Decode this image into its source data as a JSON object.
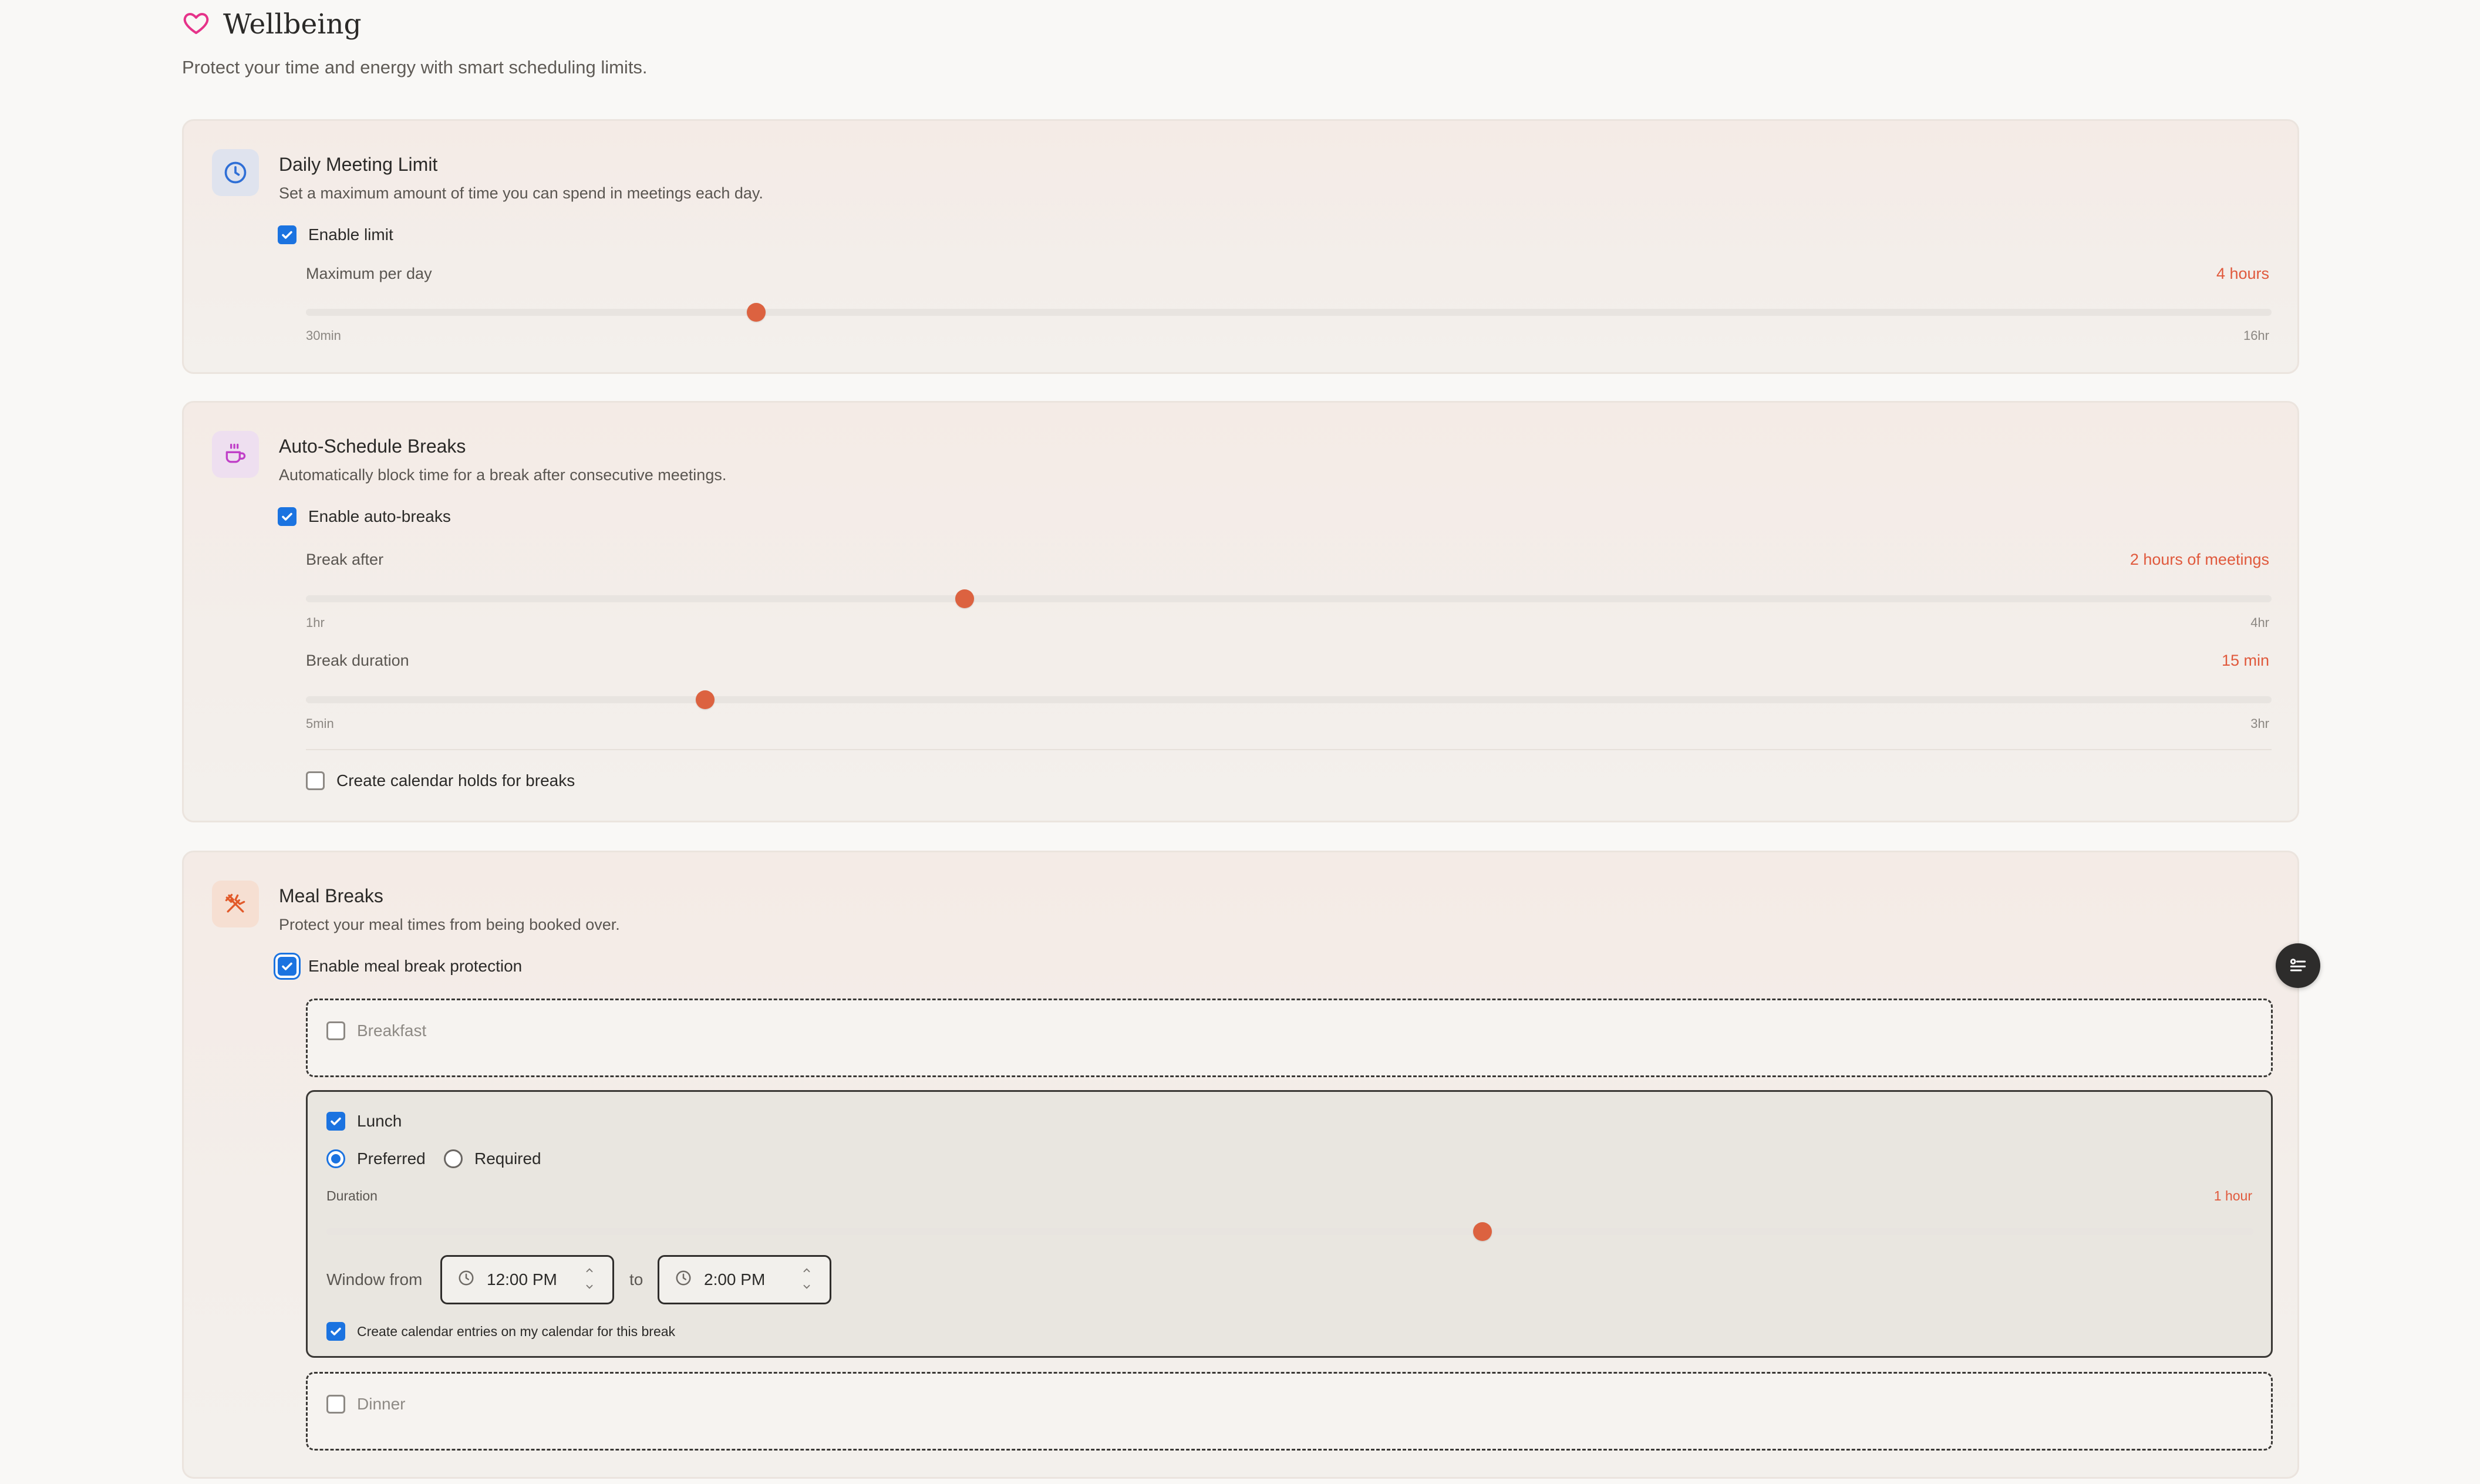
{
  "page": {
    "title": "Wellbeing",
    "subtitle": "Protect your time and energy with smart scheduling limits.",
    "icons": {
      "title": "heart-icon",
      "floating": "filter-list-icon"
    }
  },
  "colors": {
    "accent": "#dc6240",
    "accent_text": "#e0593c",
    "checkbox": "#1b73e0",
    "title_icon": "#e6338a"
  },
  "daily_limit": {
    "title": "Daily Meeting Limit",
    "description": "Set a maximum amount of time you can spend in meetings each day.",
    "icon": "clock-icon",
    "enable_label": "Enable limit",
    "enabled": true,
    "slider": {
      "label": "Maximum per day",
      "value_text": "4 hours",
      "fraction": 0.229,
      "min_label": "30min",
      "max_label": "16hr"
    }
  },
  "auto_breaks": {
    "title": "Auto-Schedule Breaks",
    "description": "Automatically block time for a break after consecutive meetings.",
    "icon": "coffee-cup-icon",
    "enable_label": "Enable auto-breaks",
    "enabled": true,
    "break_after": {
      "label": "Break after",
      "value_text": "2 hours of meetings",
      "fraction": 0.335,
      "min_label": "1hr",
      "max_label": "4hr"
    },
    "break_duration": {
      "label": "Break duration",
      "value_text": "15 min",
      "fraction": 0.203,
      "min_label": "5min",
      "max_label": "3hr"
    },
    "calendar_holds_label": "Create calendar holds for breaks",
    "calendar_holds": false
  },
  "meal_breaks": {
    "title": "Meal Breaks",
    "description": "Protect your meal times from being booked over.",
    "icon": "fork-knife-icon",
    "enable_label": "Enable meal break protection",
    "enabled": true,
    "breakfast": {
      "label": "Breakfast",
      "checked": false
    },
    "lunch": {
      "label": "Lunch",
      "checked": true,
      "preferred_label": "Preferred",
      "required_label": "Required",
      "mode": "Preferred",
      "duration_label": "Duration",
      "duration_value": "1 hour",
      "duration_fraction": 0.6,
      "window_label": "Window from",
      "from": "12:00 PM",
      "to_label": "to",
      "to": "2:00 PM",
      "calendar_label": "Create calendar entries on my calendar for this break",
      "calendar_checked": true
    },
    "dinner": {
      "label": "Dinner",
      "checked": false
    }
  }
}
